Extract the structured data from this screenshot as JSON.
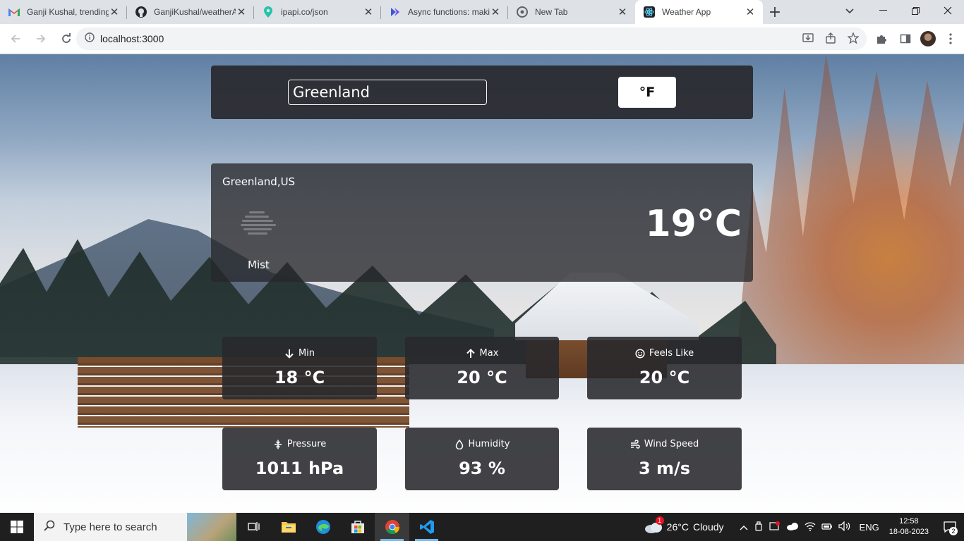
{
  "browser": {
    "tabs": [
      {
        "title": "Ganji Kushal, trending",
        "icon": "gmail-icon"
      },
      {
        "title": "GanjiKushal/weatherA",
        "icon": "github-icon"
      },
      {
        "title": "ipapi.co/json",
        "icon": "map-pin-icon"
      },
      {
        "title": "Async functions: makin",
        "icon": "vscode-docs-icon"
      },
      {
        "title": "New Tab",
        "icon": "chrome-icon"
      },
      {
        "title": "Weather App",
        "icon": "react-icon",
        "active": true
      }
    ],
    "url": "localhost:3000"
  },
  "app": {
    "search": {
      "value": "Greenland"
    },
    "unit_toggle_label": "°F",
    "current": {
      "location": "Greenland,US",
      "description": "Mist",
      "temperature": "19°C",
      "icon": "mist-icon"
    },
    "stats": [
      {
        "label": "Min",
        "value": "18 °C",
        "icon": "arrow-down-icon"
      },
      {
        "label": "Max",
        "value": "20 °C",
        "icon": "arrow-up-icon"
      },
      {
        "label": "Feels Like",
        "value": "20 °C",
        "icon": "smile-icon"
      },
      {
        "label": "Pressure",
        "value": "1011 hPa",
        "icon": "compress-icon"
      },
      {
        "label": "Humidity",
        "value": "93 %",
        "icon": "droplet-icon"
      },
      {
        "label": "Wind Speed",
        "value": "3 m/s",
        "icon": "wind-icon"
      }
    ]
  },
  "taskbar": {
    "search_placeholder": "Type here to search",
    "weather_temp": "26°C",
    "weather_text": "Cloudy",
    "language": "ENG",
    "time": "12:58",
    "date": "18-08-2023",
    "notification_count": "2",
    "weather_alert_count": "1"
  }
}
